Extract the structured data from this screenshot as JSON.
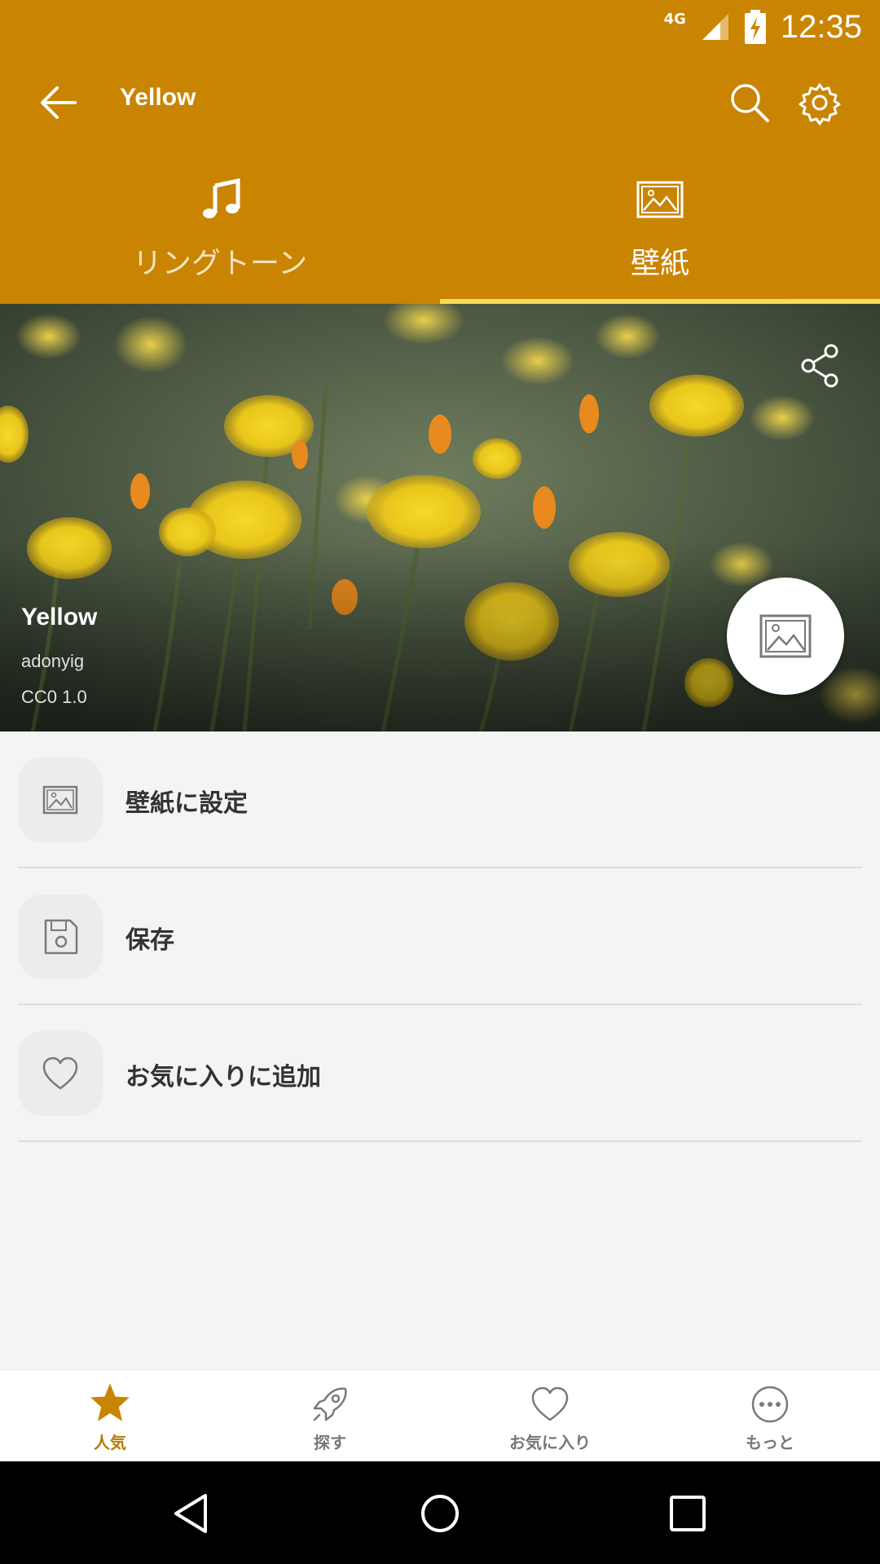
{
  "status": {
    "network": "4G",
    "time": "12:35"
  },
  "app_bar": {
    "title": "Yellow"
  },
  "tabs": [
    {
      "label": "リングトーン",
      "icon": "music-note-icon",
      "selected": false
    },
    {
      "label": "壁紙",
      "icon": "image-icon",
      "selected": true
    }
  ],
  "item": {
    "title": "Yellow",
    "author": "adonyig",
    "license": "CC0 1.0"
  },
  "actions": [
    {
      "label": "壁紙に設定",
      "icon": "image-icon"
    },
    {
      "label": "保存",
      "icon": "save-icon"
    },
    {
      "label": "お気に入りに追加",
      "icon": "heart-icon"
    }
  ],
  "bottom_nav": [
    {
      "label": "人気",
      "icon": "star-icon",
      "active": true
    },
    {
      "label": "探す",
      "icon": "rocket-icon",
      "active": false
    },
    {
      "label": "お気に入り",
      "icon": "heart-icon",
      "active": false
    },
    {
      "label": "もっと",
      "icon": "more-icon",
      "active": false
    }
  ],
  "colors": {
    "primary": "#c98402",
    "accent": "#f6dc5a",
    "active_nav": "#b57a08"
  }
}
